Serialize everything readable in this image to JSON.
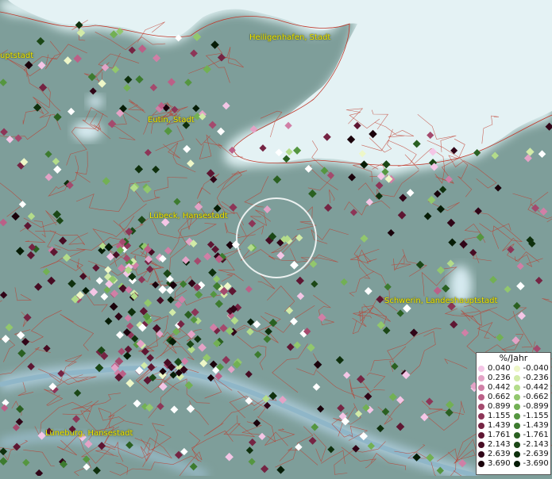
{
  "labels": {
    "heiligenhafen": "Heiligenhafen, Stadt",
    "eutin": "Eutin, Stadt",
    "luebeck": "Lübeck, Hansestadt",
    "schwerin": "Schwerin, Landeshauptstadt",
    "lueneburg": "Lüneburg, Hansestadt",
    "kiel_partial": "uptstadt"
  },
  "legend": {
    "title": "%/Jahr",
    "positive": [
      {
        "value": "0.040",
        "color": "#f4c6e6"
      },
      {
        "value": "0.236",
        "color": "#e3a3c6"
      },
      {
        "value": "0.442",
        "color": "#d07fa6"
      },
      {
        "value": "0.662",
        "color": "#bb6087"
      },
      {
        "value": "0.899",
        "color": "#a44a6d"
      },
      {
        "value": "1.155",
        "color": "#8d3557"
      },
      {
        "value": "1.439",
        "color": "#752443"
      },
      {
        "value": "1.761",
        "color": "#5e1632"
      },
      {
        "value": "2.143",
        "color": "#470c23"
      },
      {
        "value": "2.639",
        "color": "#300517"
      },
      {
        "value": "3.690",
        "color": "#1a020b"
      }
    ],
    "negative": [
      {
        "value": "-0.040",
        "color": "#eef7c8"
      },
      {
        "value": "-0.236",
        "color": "#d2eba8"
      },
      {
        "value": "-0.442",
        "color": "#b3dc8a"
      },
      {
        "value": "-0.662",
        "color": "#92c76d"
      },
      {
        "value": "-0.899",
        "color": "#72b054"
      },
      {
        "value": "-1.155",
        "color": "#559640"
      },
      {
        "value": "-1.439",
        "color": "#3d7b2f"
      },
      {
        "value": "-1.761",
        "color": "#2a6021"
      },
      {
        "value": "-2.143",
        "color": "#1b4716"
      },
      {
        "value": "-2.639",
        "color": "#0f300d"
      },
      {
        "value": "-3.690",
        "color": "#061c06"
      }
    ]
  }
}
